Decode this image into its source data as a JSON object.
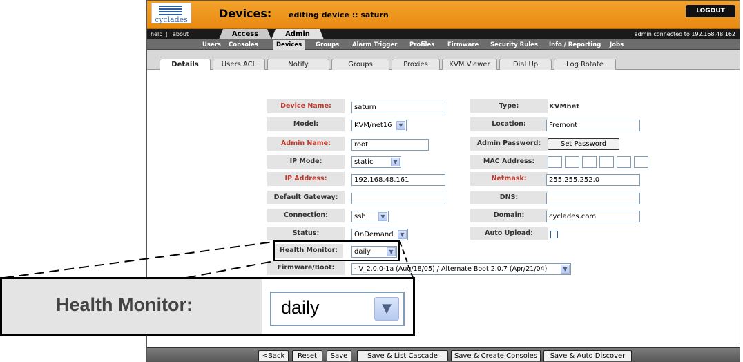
{
  "header": {
    "logo_text": "cyclades",
    "title": "Devices:",
    "subtitle": "editing device :: saturn",
    "logout": "LOGOUT"
  },
  "topnav": {
    "help": "help",
    "separator": "|",
    "about": "about",
    "tabs": [
      "Access",
      "Admin"
    ],
    "connection": "admin connected to 192.168.48.162"
  },
  "subnav": [
    "Users",
    "Consoles",
    "Devices",
    "Groups",
    "Alarm Trigger",
    "Profiles",
    "Firmware",
    "Security Rules",
    "Info / Reporting",
    "Jobs"
  ],
  "tabs": [
    "Details",
    "Users ACL",
    "Notify",
    "Groups",
    "Proxies",
    "KVM Viewer",
    "Dial Up",
    "Log Rotate"
  ],
  "form": {
    "device_name": {
      "label": "Device Name:",
      "value": "saturn"
    },
    "type": {
      "label": "Type:",
      "value": "KVMnet"
    },
    "model": {
      "label": "Model:",
      "value": "KVM/net16"
    },
    "location": {
      "label": "Location:",
      "value": "Fremont"
    },
    "admin_name": {
      "label": "Admin Name:",
      "value": "root"
    },
    "admin_password": {
      "label": "Admin Password:",
      "button": "Set Password"
    },
    "ip_mode": {
      "label": "IP Mode:",
      "value": "static"
    },
    "mac_address": {
      "label": "MAC Address:"
    },
    "ip_address": {
      "label": "IP Address:",
      "value": "192.168.48.161"
    },
    "netmask": {
      "label": "Netmask:",
      "value": "255.255.252.0"
    },
    "default_gateway": {
      "label": "Default Gateway:",
      "value": ""
    },
    "dns": {
      "label": "DNS:",
      "value": ""
    },
    "connection": {
      "label": "Connection:",
      "value": "ssh"
    },
    "domain": {
      "label": "Domain:",
      "value": "cyclades.com"
    },
    "status": {
      "label": "Status:",
      "value": "OnDemand"
    },
    "auto_upload": {
      "label": "Auto Upload:"
    },
    "health_monitor": {
      "label": "Health Monitor:",
      "value": "daily"
    },
    "firmware_boot": {
      "label": "Firmware/Boot:",
      "value": "- V_2.0.0-1a (Aug/18/05) / Alternate Boot 2.0.7 (Apr/21/04)"
    }
  },
  "footer": [
    "<Back",
    "Reset",
    "Save",
    "Save & List Cascade",
    "Save & Create Consoles",
    "Save & Auto Discover"
  ],
  "zoom": {
    "label": "Health Monitor:",
    "value": "daily"
  },
  "colors": {
    "header": "#e88a12",
    "required": "#c0392b",
    "nav": "#1a1a1a"
  }
}
